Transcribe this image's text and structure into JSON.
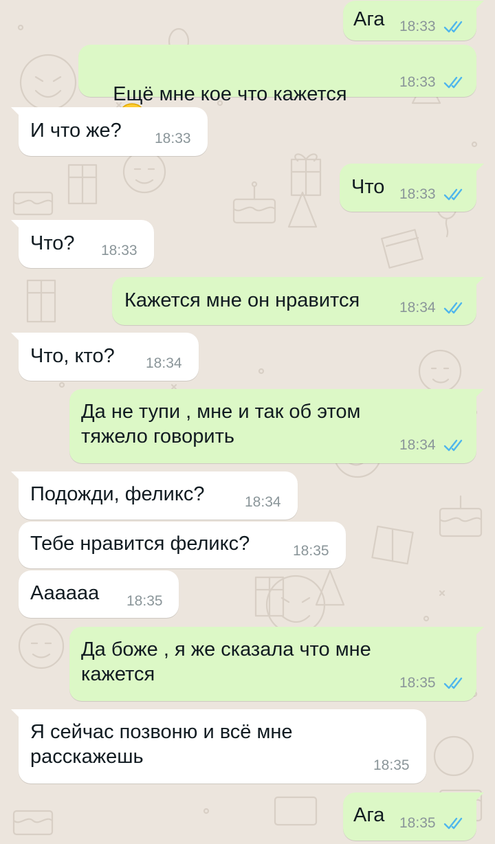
{
  "theme": {
    "outgoing_bubble": "#dcf8c6",
    "incoming_bubble": "#ffffff",
    "chat_background": "#ece5dd",
    "read_ticks": "#4fb6ec",
    "timestamp": "#8a9599"
  },
  "messages": [
    {
      "direction": "out",
      "text": "Ага",
      "time": "18:33",
      "status": "read"
    },
    {
      "direction": "out",
      "text": "Ещё мне кое что кажется",
      "emoji": "grimacing-face",
      "time": "18:33",
      "status": "read"
    },
    {
      "direction": "in",
      "text": "И что же?",
      "time": "18:33"
    },
    {
      "direction": "out",
      "text": "Что",
      "time": "18:33",
      "status": "read"
    },
    {
      "direction": "in",
      "text": "Что?",
      "time": "18:33"
    },
    {
      "direction": "out",
      "text": "Кажется мне он нравится",
      "time": "18:34",
      "status": "read"
    },
    {
      "direction": "in",
      "text": "Что, кто?",
      "time": "18:34"
    },
    {
      "direction": "out",
      "text": "Да не тупи , мне и так об этом\nтяжело говорить",
      "time": "18:34",
      "status": "read"
    },
    {
      "direction": "in",
      "text": "Подожди, феликс?",
      "time": "18:34"
    },
    {
      "direction": "in",
      "text": "Тебе нравится феликс?",
      "time": "18:35"
    },
    {
      "direction": "in",
      "text": "Аааааа",
      "time": "18:35"
    },
    {
      "direction": "out",
      "text": "Да боже , я же сказала что мне\nкажется",
      "time": "18:35",
      "status": "read"
    },
    {
      "direction": "in",
      "text": "Я сейчас позвоню и всё мне\nрасскажешь",
      "time": "18:35"
    },
    {
      "direction": "out",
      "text": "Ага",
      "time": "18:35",
      "status": "read"
    }
  ]
}
